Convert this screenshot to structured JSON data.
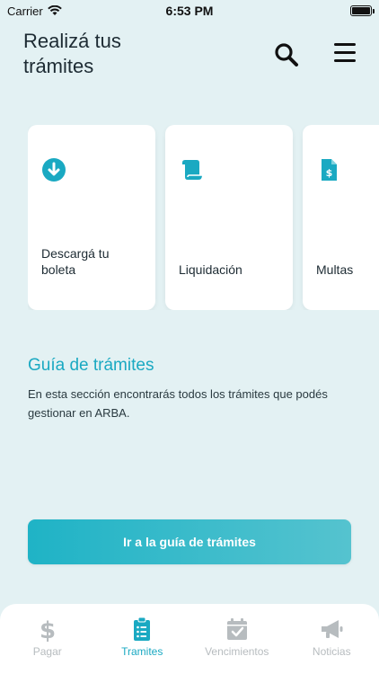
{
  "status_bar": {
    "carrier": "Carrier",
    "time": "6:53 PM"
  },
  "header": {
    "title": "Realizá tus trámites"
  },
  "cards": [
    {
      "label": "Descargá tu boleta",
      "icon": "download-circle-icon"
    },
    {
      "label": "Liquidación",
      "icon": "scroll-icon"
    },
    {
      "label": "Multas",
      "icon": "invoice-dollar-icon"
    }
  ],
  "guide": {
    "title": "Guía de trámites",
    "description": "En esta sección encontrarás todos los trámites que podés gestionar en ARBA.",
    "button_label": "Ir a la guía de trámites"
  },
  "tabs": [
    {
      "label": "Pagar",
      "icon": "dollar-icon",
      "active": false
    },
    {
      "label": "Tramites",
      "icon": "clipboard-list-icon",
      "active": true
    },
    {
      "label": "Vencimientos",
      "icon": "calendar-check-icon",
      "active": false
    },
    {
      "label": "Noticias",
      "icon": "megaphone-icon",
      "active": false
    }
  ],
  "colors": {
    "accent": "#1aa9c2",
    "background": "#e3f1f3",
    "inactive_tab": "#b7bcbf"
  }
}
